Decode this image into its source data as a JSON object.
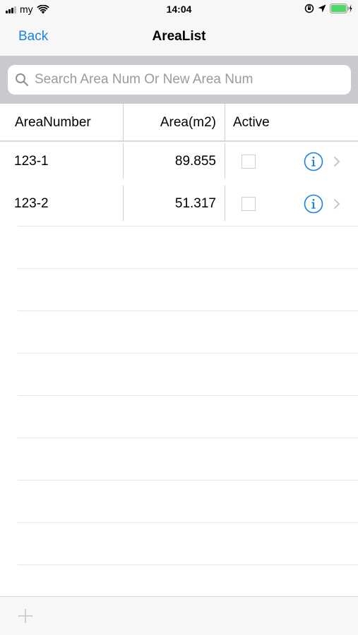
{
  "status_bar": {
    "carrier": "my",
    "time": "14:04"
  },
  "nav": {
    "back_label": "Back",
    "title": "AreaList"
  },
  "search": {
    "placeholder": "Search Area Num Or New Area Num",
    "value": ""
  },
  "table": {
    "columns": [
      "AreaNumber",
      "Area(m2)",
      "Active"
    ],
    "rows": [
      {
        "area_number": "123-1",
        "area": "89.855",
        "active": false
      },
      {
        "area_number": "123-2",
        "area": "51.317",
        "active": false
      }
    ]
  },
  "icons": {
    "search": "search-icon",
    "info": "info-icon",
    "chevron": "chevron-right-icon",
    "add": "add-icon"
  },
  "colors": {
    "accent": "#1a82e0",
    "battery": "#4cd964",
    "search_bg": "#c9c9ce"
  }
}
